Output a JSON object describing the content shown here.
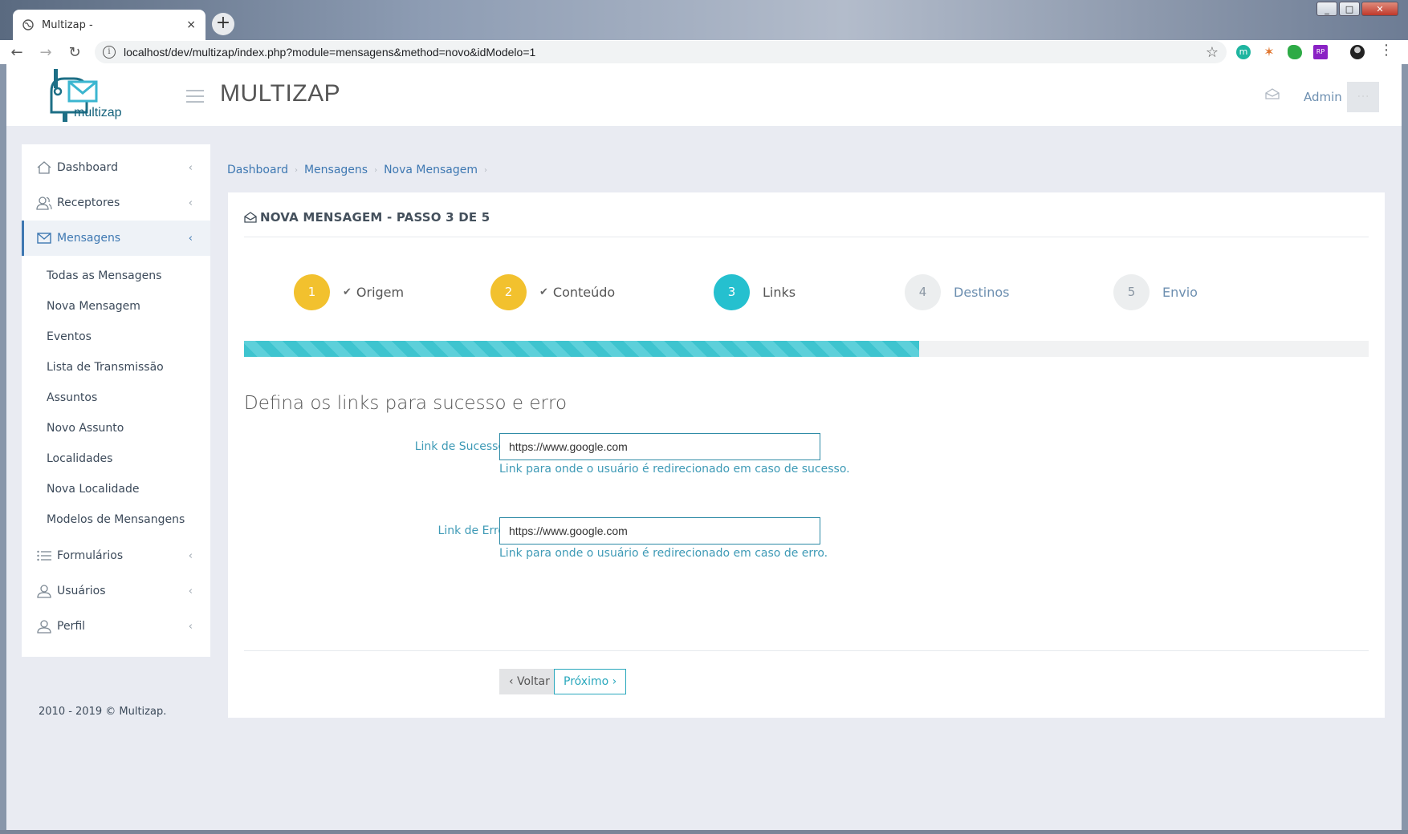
{
  "browser": {
    "tab_title": "Multizap -",
    "tab_close": "×",
    "new_tab": "+",
    "url": "localhost/dev/multizap/index.php?module=mensagens&method=novo&idModelo=1",
    "ext_m_label": "m",
    "ext_rp_label": "RP"
  },
  "header": {
    "logo_text": "multizap",
    "app_title": "MULTIZAP",
    "user_name": "Admin"
  },
  "sidebar": {
    "items": [
      {
        "label": "Dashboard",
        "icon": "home-icon"
      },
      {
        "label": "Receptores",
        "icon": "users-icon"
      },
      {
        "label": "Mensagens",
        "icon": "envelope-icon",
        "active": true
      },
      {
        "label": "Formulários",
        "icon": "list-icon"
      },
      {
        "label": "Usuários",
        "icon": "user-icon"
      },
      {
        "label": "Perfil",
        "icon": "user-icon"
      }
    ],
    "submenu": [
      "Todas as Mensagens",
      "Nova Mensagem",
      "Eventos",
      "Lista de Transmissão",
      "Assuntos",
      "Novo Assunto",
      "Localidades",
      "Nova Localidade",
      "Modelos de Mensangens"
    ]
  },
  "breadcrumb": [
    "Dashboard",
    "Mensagens",
    "Nova Mensagem"
  ],
  "card": {
    "title": "NOVA MENSAGEM - PASSO 3 DE 5",
    "steps": [
      {
        "num": "1",
        "label": "Origem",
        "state": "done"
      },
      {
        "num": "2",
        "label": "Conteúdo",
        "state": "done"
      },
      {
        "num": "3",
        "label": "Links",
        "state": "current"
      },
      {
        "num": "4",
        "label": "Destinos",
        "state": "todo"
      },
      {
        "num": "5",
        "label": "Envio",
        "state": "todo"
      }
    ],
    "progress_fraction": 0.6,
    "section_title": "Defina os links para sucesso e erro",
    "fields": {
      "success": {
        "label": "Link de Sucesso",
        "value": "https://www.google.com",
        "help": "Link para onde o usuário é redirecionado em caso de sucesso."
      },
      "error": {
        "label": "Link de Erro",
        "value": "https://www.google.com",
        "help": "Link para onde o usuário é redirecionado em caso de erro."
      }
    },
    "back_label": "‹ Voltar",
    "next_label": "Próximo ›"
  },
  "footer": "2010 - 2019 © Multizap.",
  "colors": {
    "accent": "#3e78b2",
    "step_done": "#f2c12e",
    "step_current": "#25c0cf",
    "progress": "#3ec4cf"
  }
}
